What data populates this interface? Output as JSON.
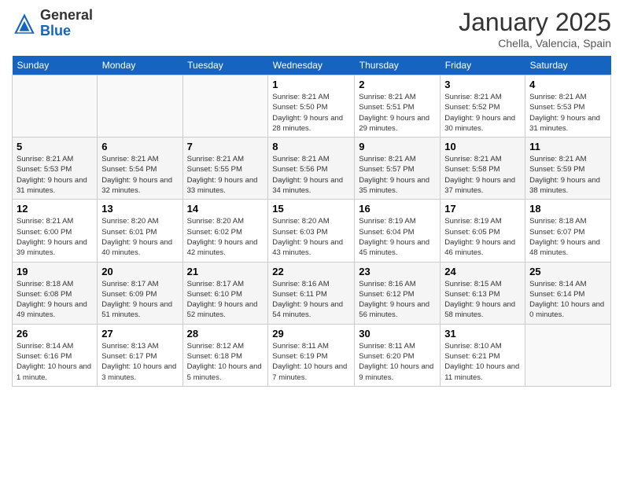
{
  "header": {
    "logo_general": "General",
    "logo_blue": "Blue",
    "month": "January 2025",
    "location": "Chella, Valencia, Spain"
  },
  "days_of_week": [
    "Sunday",
    "Monday",
    "Tuesday",
    "Wednesday",
    "Thursday",
    "Friday",
    "Saturday"
  ],
  "weeks": [
    [
      {
        "day": "",
        "info": ""
      },
      {
        "day": "",
        "info": ""
      },
      {
        "day": "",
        "info": ""
      },
      {
        "day": "1",
        "info": "Sunrise: 8:21 AM\nSunset: 5:50 PM\nDaylight: 9 hours\nand 28 minutes."
      },
      {
        "day": "2",
        "info": "Sunrise: 8:21 AM\nSunset: 5:51 PM\nDaylight: 9 hours\nand 29 minutes."
      },
      {
        "day": "3",
        "info": "Sunrise: 8:21 AM\nSunset: 5:52 PM\nDaylight: 9 hours\nand 30 minutes."
      },
      {
        "day": "4",
        "info": "Sunrise: 8:21 AM\nSunset: 5:53 PM\nDaylight: 9 hours\nand 31 minutes."
      }
    ],
    [
      {
        "day": "5",
        "info": "Sunrise: 8:21 AM\nSunset: 5:53 PM\nDaylight: 9 hours\nand 31 minutes."
      },
      {
        "day": "6",
        "info": "Sunrise: 8:21 AM\nSunset: 5:54 PM\nDaylight: 9 hours\nand 32 minutes."
      },
      {
        "day": "7",
        "info": "Sunrise: 8:21 AM\nSunset: 5:55 PM\nDaylight: 9 hours\nand 33 minutes."
      },
      {
        "day": "8",
        "info": "Sunrise: 8:21 AM\nSunset: 5:56 PM\nDaylight: 9 hours\nand 34 minutes."
      },
      {
        "day": "9",
        "info": "Sunrise: 8:21 AM\nSunset: 5:57 PM\nDaylight: 9 hours\nand 35 minutes."
      },
      {
        "day": "10",
        "info": "Sunrise: 8:21 AM\nSunset: 5:58 PM\nDaylight: 9 hours\nand 37 minutes."
      },
      {
        "day": "11",
        "info": "Sunrise: 8:21 AM\nSunset: 5:59 PM\nDaylight: 9 hours\nand 38 minutes."
      }
    ],
    [
      {
        "day": "12",
        "info": "Sunrise: 8:21 AM\nSunset: 6:00 PM\nDaylight: 9 hours\nand 39 minutes."
      },
      {
        "day": "13",
        "info": "Sunrise: 8:20 AM\nSunset: 6:01 PM\nDaylight: 9 hours\nand 40 minutes."
      },
      {
        "day": "14",
        "info": "Sunrise: 8:20 AM\nSunset: 6:02 PM\nDaylight: 9 hours\nand 42 minutes."
      },
      {
        "day": "15",
        "info": "Sunrise: 8:20 AM\nSunset: 6:03 PM\nDaylight: 9 hours\nand 43 minutes."
      },
      {
        "day": "16",
        "info": "Sunrise: 8:19 AM\nSunset: 6:04 PM\nDaylight: 9 hours\nand 45 minutes."
      },
      {
        "day": "17",
        "info": "Sunrise: 8:19 AM\nSunset: 6:05 PM\nDaylight: 9 hours\nand 46 minutes."
      },
      {
        "day": "18",
        "info": "Sunrise: 8:18 AM\nSunset: 6:07 PM\nDaylight: 9 hours\nand 48 minutes."
      }
    ],
    [
      {
        "day": "19",
        "info": "Sunrise: 8:18 AM\nSunset: 6:08 PM\nDaylight: 9 hours\nand 49 minutes."
      },
      {
        "day": "20",
        "info": "Sunrise: 8:17 AM\nSunset: 6:09 PM\nDaylight: 9 hours\nand 51 minutes."
      },
      {
        "day": "21",
        "info": "Sunrise: 8:17 AM\nSunset: 6:10 PM\nDaylight: 9 hours\nand 52 minutes."
      },
      {
        "day": "22",
        "info": "Sunrise: 8:16 AM\nSunset: 6:11 PM\nDaylight: 9 hours\nand 54 minutes."
      },
      {
        "day": "23",
        "info": "Sunrise: 8:16 AM\nSunset: 6:12 PM\nDaylight: 9 hours\nand 56 minutes."
      },
      {
        "day": "24",
        "info": "Sunrise: 8:15 AM\nSunset: 6:13 PM\nDaylight: 9 hours\nand 58 minutes."
      },
      {
        "day": "25",
        "info": "Sunrise: 8:14 AM\nSunset: 6:14 PM\nDaylight: 10 hours\nand 0 minutes."
      }
    ],
    [
      {
        "day": "26",
        "info": "Sunrise: 8:14 AM\nSunset: 6:16 PM\nDaylight: 10 hours\nand 1 minute."
      },
      {
        "day": "27",
        "info": "Sunrise: 8:13 AM\nSunset: 6:17 PM\nDaylight: 10 hours\nand 3 minutes."
      },
      {
        "day": "28",
        "info": "Sunrise: 8:12 AM\nSunset: 6:18 PM\nDaylight: 10 hours\nand 5 minutes."
      },
      {
        "day": "29",
        "info": "Sunrise: 8:11 AM\nSunset: 6:19 PM\nDaylight: 10 hours\nand 7 minutes."
      },
      {
        "day": "30",
        "info": "Sunrise: 8:11 AM\nSunset: 6:20 PM\nDaylight: 10 hours\nand 9 minutes."
      },
      {
        "day": "31",
        "info": "Sunrise: 8:10 AM\nSunset: 6:21 PM\nDaylight: 10 hours\nand 11 minutes."
      },
      {
        "day": "",
        "info": ""
      }
    ]
  ]
}
